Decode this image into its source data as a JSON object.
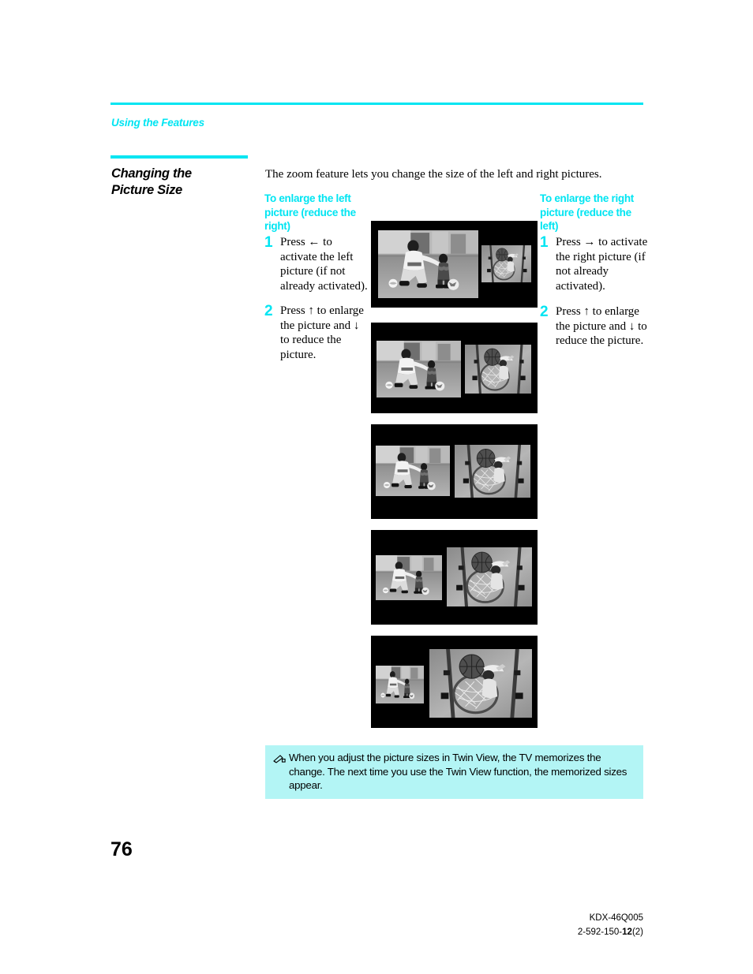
{
  "page": {
    "running_head": "Using the Features",
    "section_title": "Changing the\nPicture Size",
    "intro": "The zoom feature lets you change the size of the left and right pictures.",
    "page_number": "76",
    "accent_color": "#00e5f2",
    "note_bg_color": "#b3f5f5"
  },
  "columns": {
    "left": {
      "heading": "To enlarge the left picture (reduce the right)",
      "steps": [
        {
          "num": "1",
          "text": "Press ← to activate the left picture (if not already activated)."
        },
        {
          "num": "2",
          "text": "Press ↑ to enlarge the picture and ↓ to reduce the picture."
        }
      ]
    },
    "right": {
      "heading": "To enlarge the right picture (reduce the left)",
      "steps": [
        {
          "num": "1",
          "text": "Press → to activate the right picture (if not already activated)."
        },
        {
          "num": "2",
          "text": "Press ↑ to enlarge the picture and ↓ to reduce the picture."
        }
      ]
    }
  },
  "figures": [
    {
      "name": "twin-view-state-1",
      "left_scene": "football-player-and-child",
      "right_scene": "basketball-hoop",
      "left_size": "largest",
      "right_size": "smallest"
    },
    {
      "name": "twin-view-state-2",
      "left_scene": "football-player-and-child",
      "right_scene": "basketball-hoop",
      "left_size": "large",
      "right_size": "small"
    },
    {
      "name": "twin-view-state-3",
      "left_scene": "football-player-and-child",
      "right_scene": "basketball-hoop",
      "left_size": "equal",
      "right_size": "equal"
    },
    {
      "name": "twin-view-state-4",
      "left_scene": "football-player-and-child",
      "right_scene": "basketball-hoop",
      "left_size": "small",
      "right_size": "large"
    },
    {
      "name": "twin-view-state-5",
      "left_scene": "football-player-and-child",
      "right_scene": "basketball-hoop",
      "left_size": "smallest",
      "right_size": "largest"
    }
  ],
  "note": {
    "icon": "pencil-note-icon",
    "text": "When you adjust the picture sizes in Twin View, the TV memorizes the change. The next time you use the Twin View function, the memorized sizes appear."
  },
  "footer": {
    "model": "KDX-46Q005",
    "doc_prefix": "2-592-150-",
    "doc_bold": "12",
    "doc_suffix": "(2)"
  }
}
